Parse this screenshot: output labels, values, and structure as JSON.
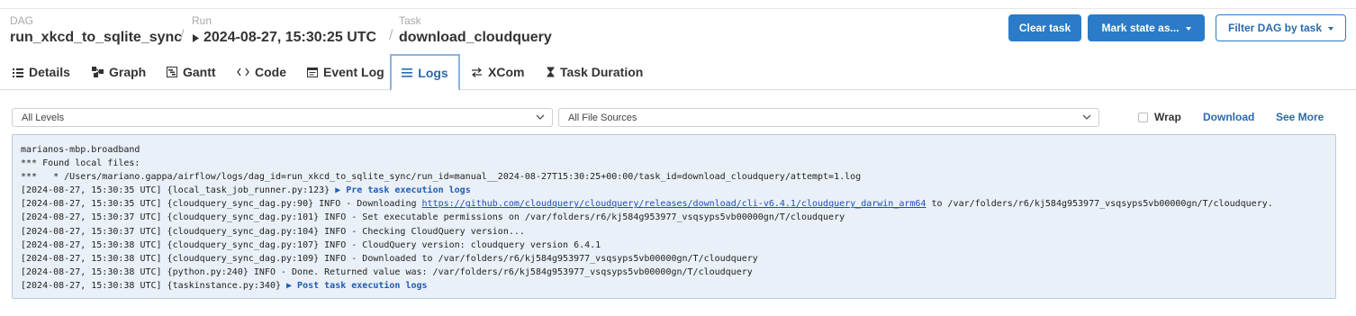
{
  "breadcrumb": {
    "dag_label": "DAG",
    "dag_value": "run_xkcd_to_sqlite_sync",
    "separator": "/",
    "run_label": "Run",
    "run_value": "2024-08-27, 15:30:25 UTC",
    "task_label": "Task",
    "task_value": "download_cloudquery"
  },
  "actions": {
    "clear_task": "Clear task",
    "mark_state": "Mark state as...",
    "filter_dag": "Filter DAG by task"
  },
  "tabs": [
    {
      "label": "Details",
      "icon": "list-icon"
    },
    {
      "label": "Graph",
      "icon": "graph-icon"
    },
    {
      "label": "Gantt",
      "icon": "gantt-icon"
    },
    {
      "label": "Code",
      "icon": "code-icon"
    },
    {
      "label": "Event Log",
      "icon": "event-log-icon"
    },
    {
      "label": "Logs",
      "icon": "lines-icon",
      "active": true
    },
    {
      "label": "XCom",
      "icon": "arrows-icon"
    },
    {
      "label": "Task Duration",
      "icon": "hourglass-icon"
    }
  ],
  "filters": {
    "levels": "All Levels",
    "sources": "All File Sources",
    "wrap_label": "Wrap",
    "wrap_checked": false,
    "download": "Download",
    "see_more": "See More"
  },
  "log": {
    "lines": [
      "marianos-mbp.broadband",
      "*** Found local files:",
      "***   * /Users/mariano.gappa/airflow/logs/dag_id=run_xkcd_to_sqlite_sync/run_id=manual__2024-08-27T15:30:25+00:00/task_id=download_cloudquery/attempt=1.log",
      "[2024-08-27, 15:30:35 UTC] {local_task_job_runner.py:123} ",
      "[2024-08-27, 15:30:35 UTC] {cloudquery_sync_dag.py:90} INFO - Downloading ",
      "[2024-08-27, 15:30:37 UTC] {cloudquery_sync_dag.py:101} INFO - Set executable permissions on /var/folders/r6/kj584g953977_vsqsyps5vb00000gn/T/cloudquery",
      "[2024-08-27, 15:30:37 UTC] {cloudquery_sync_dag.py:104} INFO - Checking CloudQuery version...",
      "[2024-08-27, 15:30:38 UTC] {cloudquery_sync_dag.py:107} INFO - CloudQuery version: cloudquery version 6.4.1",
      "[2024-08-27, 15:30:38 UTC] {cloudquery_sync_dag.py:109} INFO - Downloaded to /var/folders/r6/kj584g953977_vsqsyps5vb00000gn/T/cloudquery",
      "[2024-08-27, 15:30:38 UTC] {python.py:240} INFO - Done. Returned value was: /var/folders/r6/kj584g953977_vsqsyps5vb00000gn/T/cloudquery",
      "[2024-08-27, 15:30:38 UTC] {taskinstance.py:340} "
    ],
    "pre_task_group": "▶ Pre task execution logs",
    "download_url": "https://github.com/cloudquery/cloudquery/releases/download/cli-v6.4.1/cloudquery_darwin_arm64",
    "download_suffix": " to /var/folders/r6/kj584g953977_vsqsyps5vb00000gn/T/cloudquery.",
    "post_task_group": "▶ Post task execution logs"
  },
  "colors": {
    "primary": "#2b7bc9",
    "link": "#2b6aad",
    "log_bg": "#eaf0f7"
  }
}
